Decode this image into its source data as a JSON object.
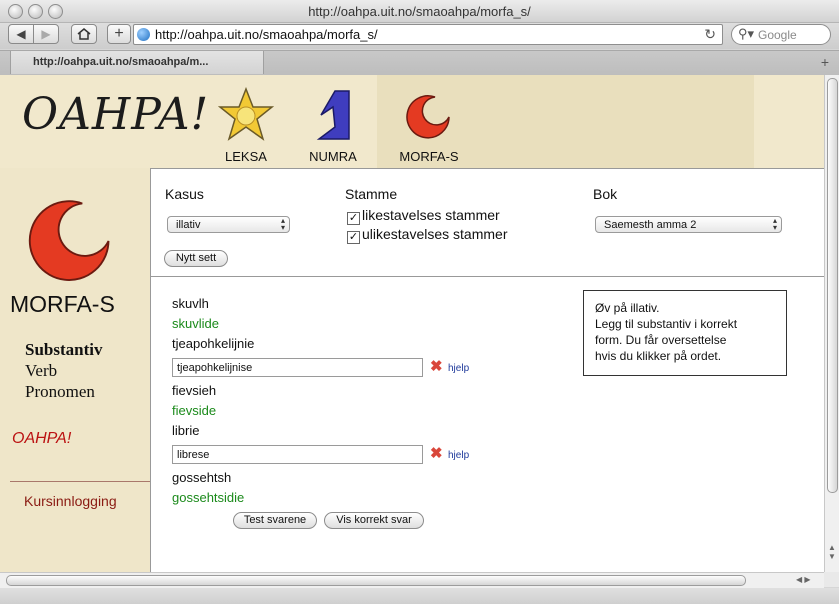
{
  "window": {
    "title": "http://oahpa.uit.no/smaoahpa/morfa_s/"
  },
  "toolbar": {
    "back_icon": "back-arrow-icon",
    "forward_icon": "forward-arrow-icon",
    "home_icon": "home-icon",
    "add_icon": "plus-icon",
    "url": "http://oahpa.uit.no/smaoahpa/morfa_s/",
    "search_placeholder": "Google"
  },
  "tabs": [
    {
      "label": "http://oahpa.uit.no/smaoahpa/m..."
    }
  ],
  "header": {
    "logo": "OAHPA!",
    "nav": [
      {
        "label": "LEKSA",
        "icon": "star-icon"
      },
      {
        "label": "NUMRA",
        "icon": "number-one-icon"
      },
      {
        "label": "MORFA-S",
        "icon": "crescent-icon"
      }
    ]
  },
  "sidebar": {
    "title": "MORFA-S",
    "menu": [
      "Substantiv",
      "Verb",
      "Pronomen"
    ],
    "small_logo": "OAHPA!",
    "login": "Kursinnlogging"
  },
  "form": {
    "kasus_label": "Kasus",
    "kasus_value": "illativ",
    "stamme_label": "Stamme",
    "stamme_options": [
      {
        "label": "likestavelses stammer",
        "checked": true
      },
      {
        "label": "ulikestavelses stammer",
        "checked": true
      }
    ],
    "bok_label": "Bok",
    "bok_value": "Saemesth amma 2",
    "new_set": "Nytt sett"
  },
  "exercises": {
    "items": [
      {
        "word": "skuvlh",
        "answer": "skuvlide"
      },
      {
        "word": "tjeapohkelijnie",
        "input": "tjeapohkelijnise"
      },
      {
        "word": "fievsieh",
        "answer": "fievside"
      },
      {
        "word": "librie",
        "input": "librese"
      },
      {
        "word": "gossehtsh",
        "answer": "gossehtsidie"
      }
    ],
    "help": "hjelp",
    "test_button": "Test svarene",
    "show_button": "Vis korrekt svar"
  },
  "info": {
    "lines": [
      "Øv på illativ.",
      "Legg til substantiv i korrekt",
      "form. Du får oversettelse",
      "hvis du klikker på ordet."
    ]
  },
  "colors": {
    "correct": "#1b8a1b",
    "wrong": "#d9463a",
    "link": "#1f3a9b",
    "login": "#8a1a12"
  }
}
